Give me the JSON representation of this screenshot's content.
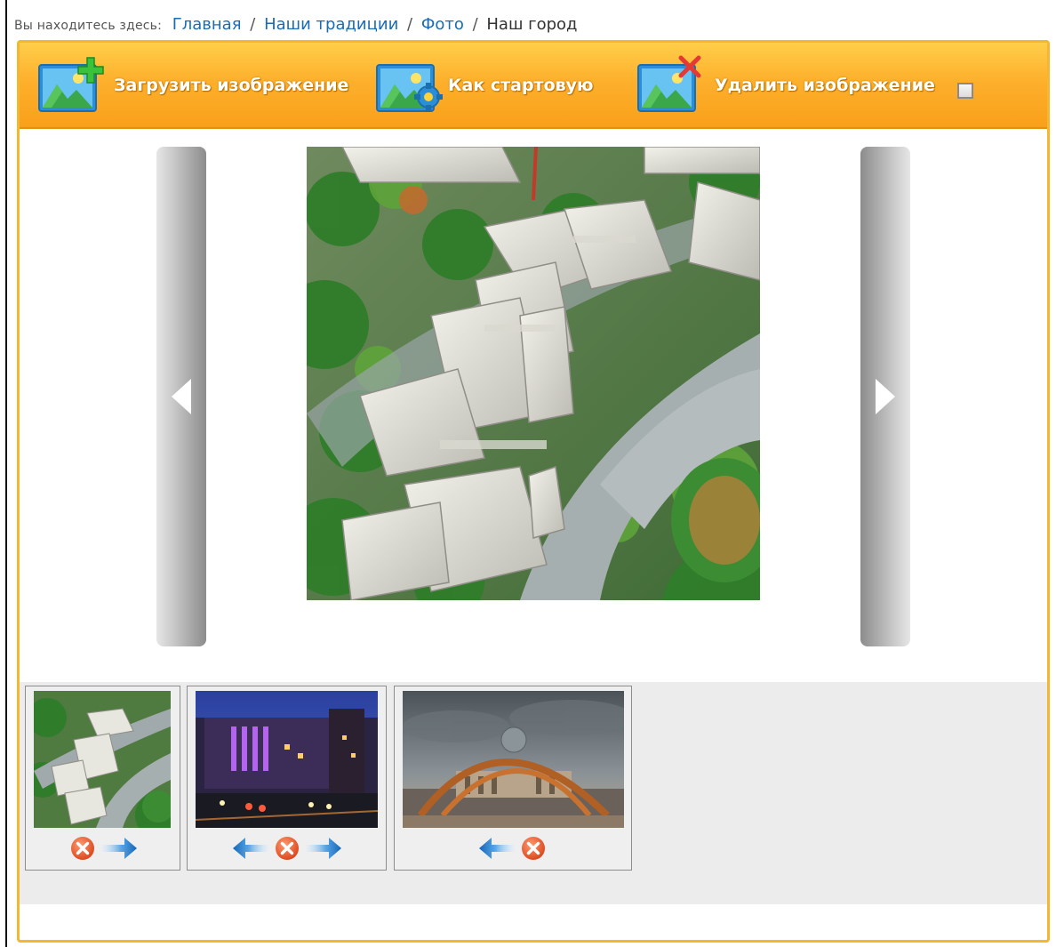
{
  "breadcrumb": {
    "prefix": "Вы находитесь здесь:",
    "links": [
      "Главная",
      "Наши традиции",
      "Фото"
    ],
    "current": "Наш город"
  },
  "toolbar": {
    "upload_label": "Загрузить изображение",
    "set_start_label": "Как стартовую",
    "delete_label": "Удалить изображение",
    "select_checkbox_checked": false
  },
  "viewer": {
    "prev_icon": "arrow-left-icon",
    "next_icon": "arrow-right-icon",
    "main_image": "aerial-city-campus-photo"
  },
  "thumbnails": [
    {
      "image": "aerial-city-campus-photo",
      "controls": [
        "delete-icon",
        "arrow-right-icon"
      ]
    },
    {
      "image": "night-building-photo",
      "controls": [
        "arrow-left-icon",
        "delete-icon",
        "arrow-right-icon"
      ]
    },
    {
      "image": "monument-arches-photo",
      "controls": [
        "arrow-left-icon",
        "delete-icon"
      ]
    }
  ],
  "colors": {
    "accent_orange": "#f9a01a",
    "frame_border": "#f5b731",
    "link_blue": "#1a6bb5",
    "delete_red": "#e8552a",
    "arrow_blue": "#1b7bd0"
  }
}
